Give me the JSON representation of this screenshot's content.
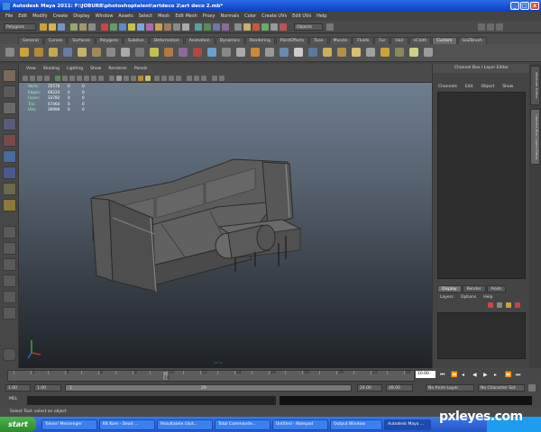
{
  "window": {
    "title": "Autodesk Maya 2011: F:\\JOBURB\\photoshoptalent\\artdeco 2\\art deco 2.mb*",
    "controls": [
      "_",
      "□",
      "x"
    ]
  },
  "menubar": [
    "File",
    "Edit",
    "Modify",
    "Create",
    "Display",
    "Window",
    "Assets",
    "Select",
    "Mesh",
    "Edit Mesh",
    "Proxy",
    "Normals",
    "Color",
    "Create UVs",
    "Edit UVs",
    "Help"
  ],
  "statusline": {
    "menuset": "Polygons",
    "selection_mode": "Objects"
  },
  "shelf_tabs": [
    "General",
    "Curves",
    "Surfaces",
    "Polygons",
    "Subdivs",
    "Deformation",
    "Animation",
    "Dynamics",
    "Rendering",
    "PaintEffects",
    "Toon",
    "Muscle",
    "Fluids",
    "Fur",
    "Hair",
    "nCloth",
    "Custom",
    "GoZBrush"
  ],
  "shelf_active": "Custom",
  "panel_menu": [
    "View",
    "Shading",
    "Lighting",
    "Show",
    "Renderer",
    "Panels"
  ],
  "hud": [
    {
      "label": "Verts:",
      "v1": "35578",
      "v2": "0",
      "v3": "0"
    },
    {
      "label": "Edges:",
      "v1": "69224",
      "v2": "0",
      "v3": "0"
    },
    {
      "label": "Faces:",
      "v1": "33782",
      "v2": "0",
      "v3": "0"
    },
    {
      "label": "Tris:",
      "v1": "67464",
      "v2": "0",
      "v3": "0"
    },
    {
      "label": "UVs:",
      "v1": "39999",
      "v2": "0",
      "v3": "0"
    }
  ],
  "camera_label": "persp",
  "channel_box": {
    "title": "Channel Box / Layer Editor",
    "menu": [
      "Channels",
      "Edit",
      "Object",
      "Show"
    ]
  },
  "layer_editor": {
    "tabs": [
      "Display",
      "Render",
      "Anim"
    ],
    "active": "Display",
    "menu": [
      "Layers",
      "Options",
      "Help"
    ]
  },
  "side_tabs": [
    "Attribute Editor",
    "Channel Box / Layer Editor"
  ],
  "time_slider": {
    "ticks": [
      "2",
      "4",
      "6",
      "8",
      "10",
      "12",
      "14",
      "16",
      "18",
      "20",
      "22",
      "24"
    ],
    "current_frame": "10",
    "end_field": "10.00"
  },
  "range_slider": {
    "start": "1.00",
    "start2": "1.00",
    "range_start": "1",
    "range_end": "29",
    "end": "24.00",
    "end2": "48.00",
    "anim_layer": "No Anim Layer",
    "char_set": "No Character Set"
  },
  "command_line": {
    "label": "MEL"
  },
  "help_line": "Select Tool: select an object",
  "taskbar": {
    "start": "start",
    "tasks": [
      "Yahoo! Messenger",
      "KK Kom - Dead ...",
      "Rezultatele căut...",
      "Total Commande...",
      "Untitled - Notepad",
      "Output Window",
      "Autodesk Maya ..."
    ],
    "active_task": "Autodesk Maya ..."
  },
  "watermark": "pxleyes.com",
  "colors": {
    "title_blue": "#0a3fc0",
    "maya_grey": "#444444",
    "hud_green": "#9ff0c0",
    "taskbar_blue": "#2556c8",
    "start_green": "#2d8a2d"
  }
}
